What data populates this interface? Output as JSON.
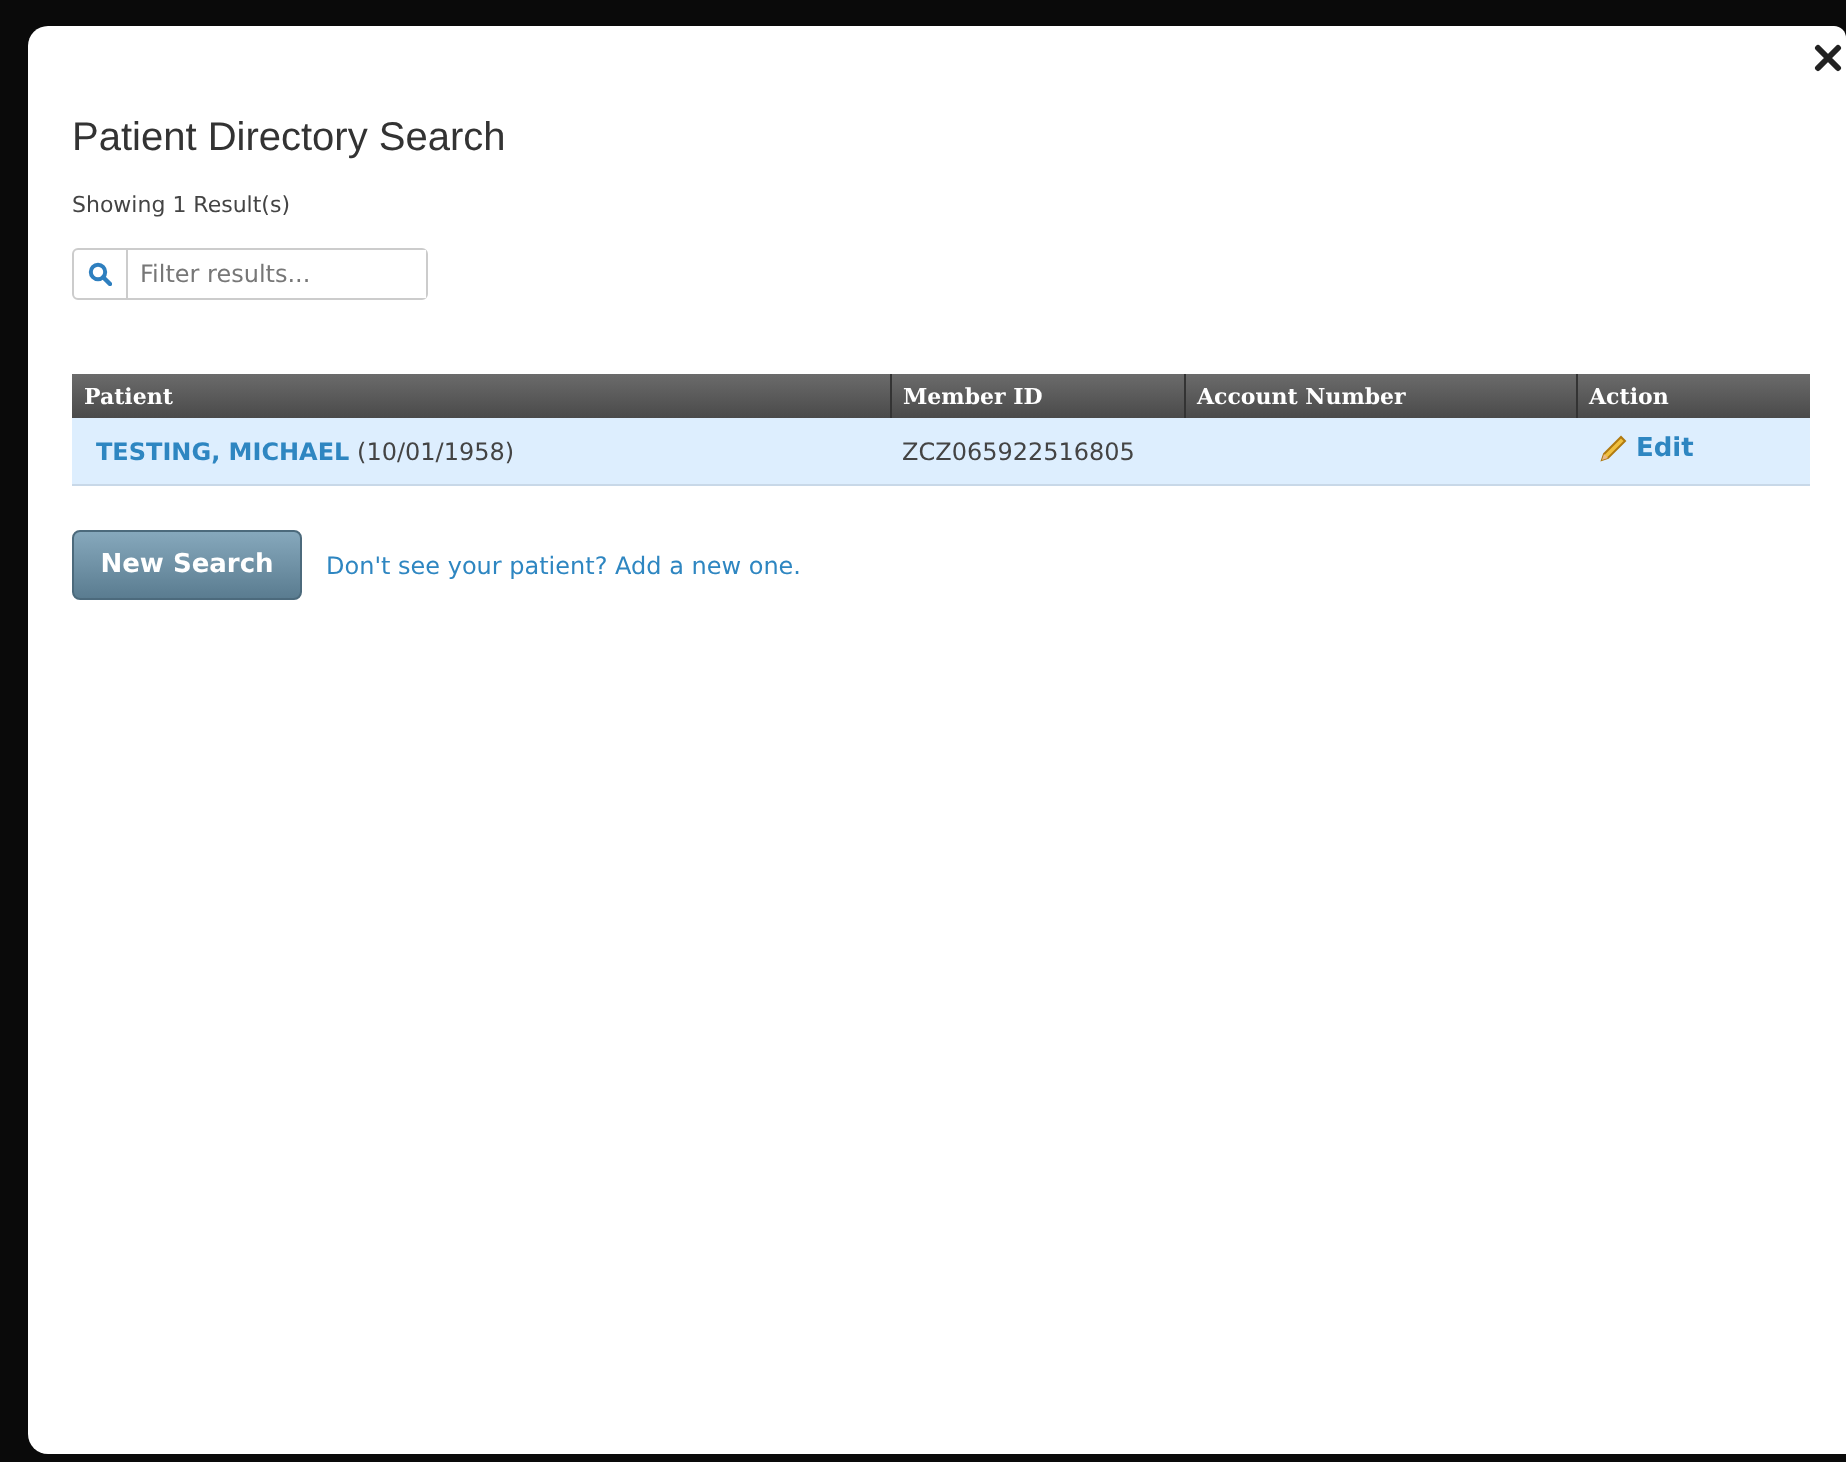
{
  "dialog": {
    "title": "Patient Directory Search",
    "result_count": "Showing 1 Result(s)"
  },
  "filter": {
    "placeholder": "Filter results..."
  },
  "table": {
    "columns": [
      "Patient",
      "Member ID",
      "Account Number",
      "Action"
    ],
    "rows": [
      {
        "name": "TESTING, MICHAEL",
        "dob": "(10/01/1958)",
        "member_id": "ZCZ065922516805",
        "action": "Edit",
        "selected": true
      }
    ]
  },
  "new_search_button": "New Search",
  "add_link": "Don't see your patient? Add a new one."
}
